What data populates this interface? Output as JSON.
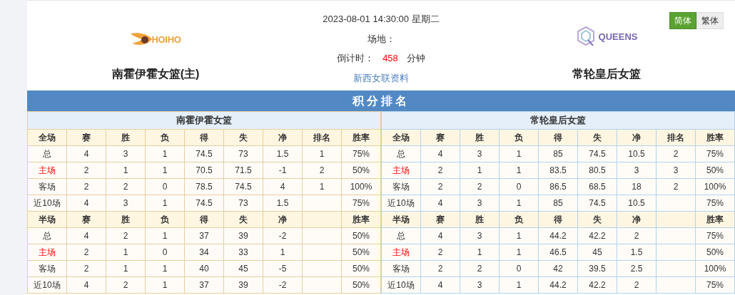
{
  "header": {
    "datetime": "2023-08-01 14:30:00 星期二",
    "venue_label": "场地：",
    "countdown_label": "倒计时：",
    "countdown_value": "458",
    "countdown_unit": "分钟",
    "league_link": "新西女联资料",
    "home": {
      "name": "南霍伊霍女篮(主)",
      "logo_text": "HOIHO"
    },
    "away": {
      "name": "常轮皇后女篮",
      "logo_text": "QUEENS"
    },
    "lang_buttons": [
      {
        "label": "简体",
        "selected": true
      },
      {
        "label": "繁体",
        "selected": false
      }
    ]
  },
  "standings": {
    "title": "积分排名",
    "tables": [
      {
        "team": "南霍伊霍女篮",
        "rows": [
          {
            "kind": "header",
            "cells": [
              "全场",
              "赛",
              "胜",
              "负",
              "得",
              "失",
              "净",
              "排名",
              "胜率"
            ]
          },
          {
            "kind": "data",
            "highlighted": false,
            "cells": [
              "总",
              "4",
              "3",
              "1",
              "74.5",
              "73",
              "1.5",
              "1",
              "75%"
            ]
          },
          {
            "kind": "data",
            "highlighted": true,
            "cells": [
              "主场",
              "2",
              "1",
              "1",
              "70.5",
              "71.5",
              "-1",
              "2",
              "50%"
            ]
          },
          {
            "kind": "data",
            "highlighted": false,
            "cells": [
              "客场",
              "2",
              "2",
              "0",
              "78.5",
              "74.5",
              "4",
              "1",
              "100%"
            ]
          },
          {
            "kind": "data",
            "highlighted": false,
            "cells": [
              "近10场",
              "4",
              "3",
              "1",
              "74.5",
              "73",
              "1.5",
              "",
              "75%"
            ]
          },
          {
            "kind": "header",
            "cells": [
              "半场",
              "赛",
              "胜",
              "负",
              "得",
              "失",
              "净",
              "",
              "胜率"
            ]
          },
          {
            "kind": "data",
            "highlighted": false,
            "cells": [
              "总",
              "4",
              "2",
              "1",
              "37",
              "39",
              "-2",
              "",
              "50%"
            ]
          },
          {
            "kind": "data",
            "highlighted": true,
            "cells": [
              "主场",
              "2",
              "1",
              "0",
              "34",
              "33",
              "1",
              "",
              "50%"
            ]
          },
          {
            "kind": "data",
            "highlighted": false,
            "cells": [
              "客场",
              "2",
              "1",
              "1",
              "40",
              "45",
              "-5",
              "",
              "50%"
            ]
          },
          {
            "kind": "data",
            "highlighted": false,
            "cells": [
              "近10场",
              "4",
              "2",
              "1",
              "37",
              "39",
              "-2",
              "",
              "50%"
            ]
          }
        ]
      },
      {
        "team": "常轮皇后女篮",
        "rows": [
          {
            "kind": "header",
            "cells": [
              "全场",
              "赛",
              "胜",
              "负",
              "得",
              "失",
              "净",
              "排名",
              "胜率"
            ]
          },
          {
            "kind": "data",
            "highlighted": false,
            "cells": [
              "总",
              "4",
              "3",
              "1",
              "85",
              "74.5",
              "10.5",
              "2",
              "75%"
            ]
          },
          {
            "kind": "data",
            "highlighted": true,
            "cells": [
              "主场",
              "2",
              "1",
              "1",
              "83.5",
              "80.5",
              "3",
              "3",
              "50%"
            ]
          },
          {
            "kind": "data",
            "highlighted": false,
            "cells": [
              "客场",
              "2",
              "2",
              "0",
              "86.5",
              "68.5",
              "18",
              "2",
              "100%"
            ]
          },
          {
            "kind": "data",
            "highlighted": false,
            "cells": [
              "近10场",
              "4",
              "3",
              "1",
              "85",
              "74.5",
              "10.5",
              "",
              "75%"
            ]
          },
          {
            "kind": "header",
            "cells": [
              "半场",
              "赛",
              "胜",
              "负",
              "得",
              "失",
              "净",
              "",
              "胜率"
            ]
          },
          {
            "kind": "data",
            "highlighted": false,
            "cells": [
              "总",
              "4",
              "3",
              "1",
              "44.2",
              "42.2",
              "2",
              "",
              "75%"
            ]
          },
          {
            "kind": "data",
            "highlighted": true,
            "cells": [
              "主场",
              "2",
              "1",
              "1",
              "46.5",
              "45",
              "1.5",
              "",
              "50%"
            ]
          },
          {
            "kind": "data",
            "highlighted": false,
            "cells": [
              "客场",
              "2",
              "2",
              "0",
              "42",
              "39.5",
              "2.5",
              "",
              "100%"
            ]
          },
          {
            "kind": "data",
            "highlighted": false,
            "cells": [
              "近10场",
              "4",
              "3",
              "1",
              "44.2",
              "42.2",
              "2",
              "",
              "75%"
            ]
          }
        ]
      }
    ]
  }
}
